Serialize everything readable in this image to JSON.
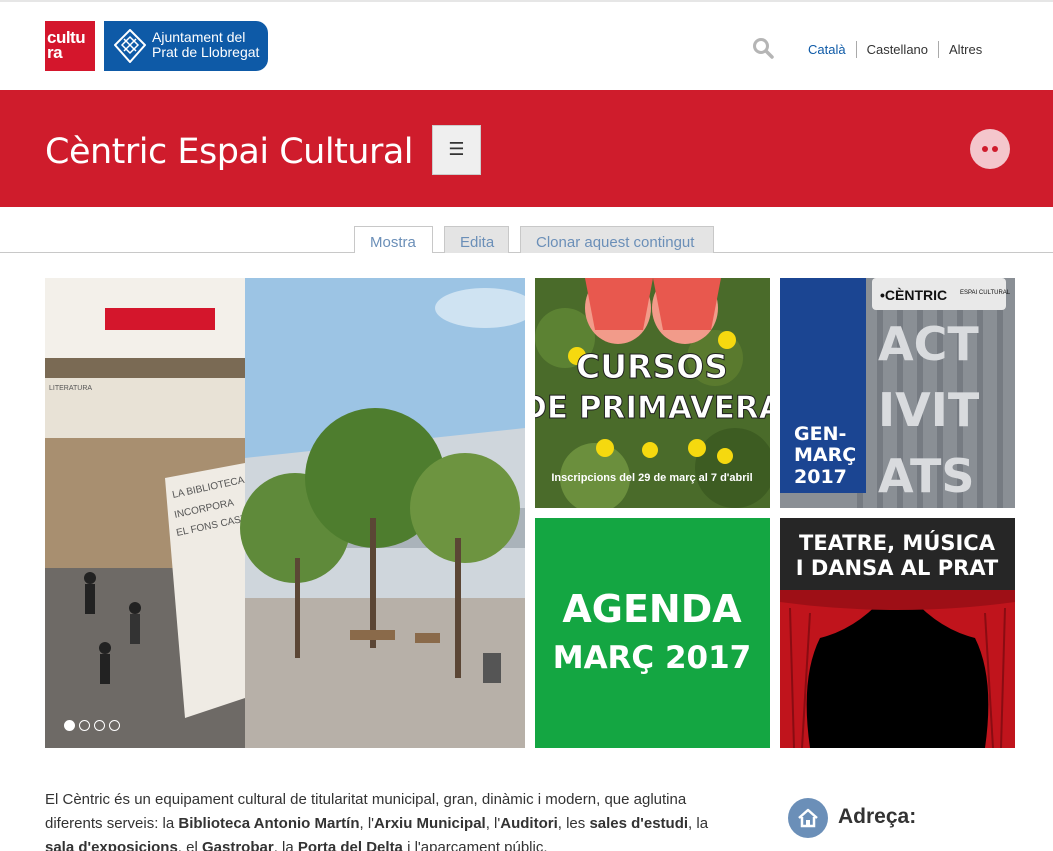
{
  "header": {
    "logo_cultura": [
      "cultu",
      "ra"
    ],
    "logo_ajuntament": [
      "Ajuntament del",
      "Prat de Llobregat"
    ],
    "languages": [
      "Català",
      "Castellano",
      "Altres"
    ]
  },
  "band": {
    "title": "Cèntric Espai Cultural",
    "menu_label": "☰"
  },
  "tabs": [
    "Mostra",
    "Edita",
    "Clonar aquest contingut"
  ],
  "tiles": {
    "slider_signs": [
      "LITERATURA",
      "LA BIBLIOTECA INCORPORA EL FONS CASTRO"
    ],
    "cursos": {
      "title1": "CURSOS",
      "title2": "DE PRIMAVERA",
      "sub": "Inscripcions del 29 de març al 7 d'abril"
    },
    "activitats": {
      "brand": "•CÈNTRIC",
      "brand_sub": "ESPAI CULTURAL",
      "letters": [
        "ACT",
        "IVIT",
        "ATS"
      ],
      "period": [
        "GEN-",
        "MARÇ",
        "2017"
      ]
    },
    "agenda": {
      "line1": "AGENDA",
      "line2": "MARÇ 2017"
    },
    "teatre": {
      "line1": "TEATRE, MÚSICA",
      "line2": "I DANSA AL PRAT"
    }
  },
  "slider_dots": 4,
  "slider_active": 0,
  "description": {
    "parts": [
      {
        "t": "El Cèntric és un equipament cultural de titularitat municipal, gran, dinàmic i modern, que aglutina diferents serveis: la ",
        "b": false
      },
      {
        "t": "Biblioteca Antonio Martín",
        "b": true
      },
      {
        "t": ", l'",
        "b": false
      },
      {
        "t": "Arxiu Municipal",
        "b": true
      },
      {
        "t": ", l'",
        "b": false
      },
      {
        "t": "Auditori",
        "b": true
      },
      {
        "t": ", les ",
        "b": false
      },
      {
        "t": "sales d'estudi",
        "b": true
      },
      {
        "t": ", la ",
        "b": false
      },
      {
        "t": "sala d'exposicions",
        "b": true
      },
      {
        "t": ", el ",
        "b": false
      },
      {
        "t": "Gastrobar",
        "b": true
      },
      {
        "t": ", la ",
        "b": false
      },
      {
        "t": "Porta del Delta",
        "b": true
      },
      {
        "t": " i l'aparcament públic.",
        "b": false
      }
    ]
  },
  "address": {
    "title": "Adreça:",
    "icon": "home-icon"
  },
  "colors": {
    "brand_red": "#cf1c2c",
    "brand_blue": "#0e5aa7",
    "link": "#6b8fb8",
    "agenda_green": "#14a642"
  }
}
